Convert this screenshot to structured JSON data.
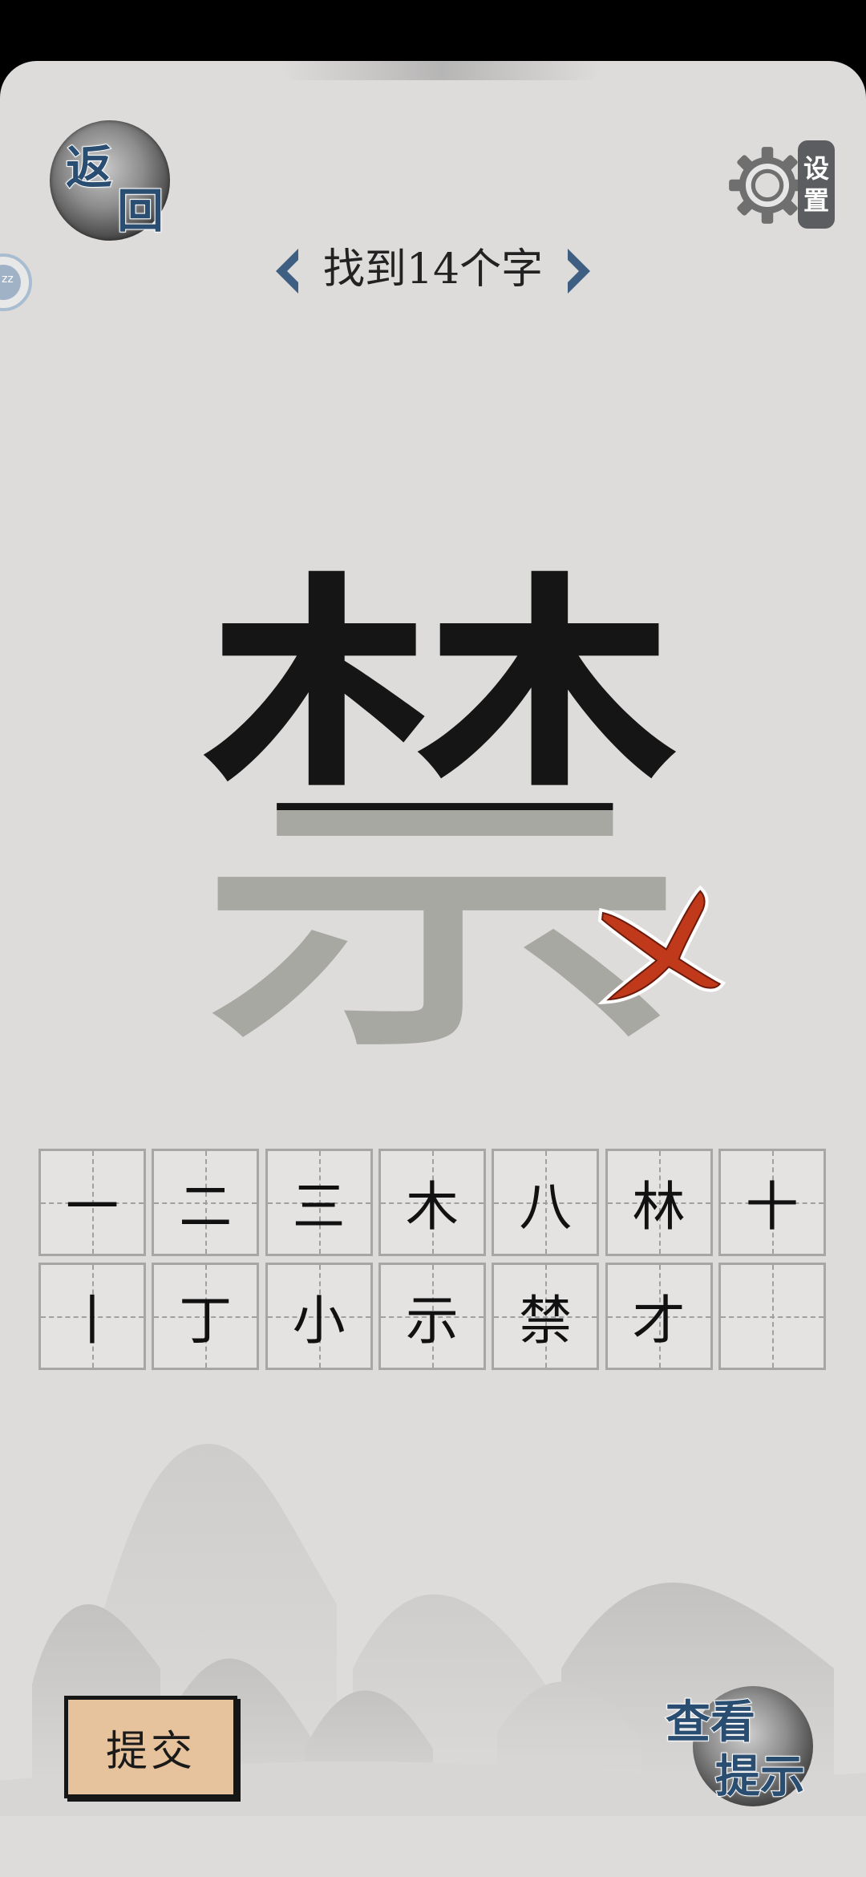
{
  "header": {
    "back_label_top": "返",
    "back_label_bottom": "回",
    "settings_label_top": "设",
    "settings_label_bottom": "置",
    "task_text": "找到14个字"
  },
  "puzzle": {
    "main_character": "禁",
    "result_mark": "wrong-x-icon",
    "colors": {
      "highlighted_part": "#151515",
      "faded_part": "#a8a8a3",
      "wrong_mark": "#c0391b"
    }
  },
  "found_characters": {
    "rows": [
      [
        "一",
        "二",
        "三",
        "木",
        "八",
        "林",
        "十"
      ],
      [
        "丨",
        "丁",
        "小",
        "示",
        "禁",
        "才",
        ""
      ]
    ]
  },
  "footer": {
    "submit_label": "提交",
    "hint_label_top": "查看",
    "hint_label_bottom": "提示"
  },
  "edge_widget": {
    "text": "zz"
  }
}
